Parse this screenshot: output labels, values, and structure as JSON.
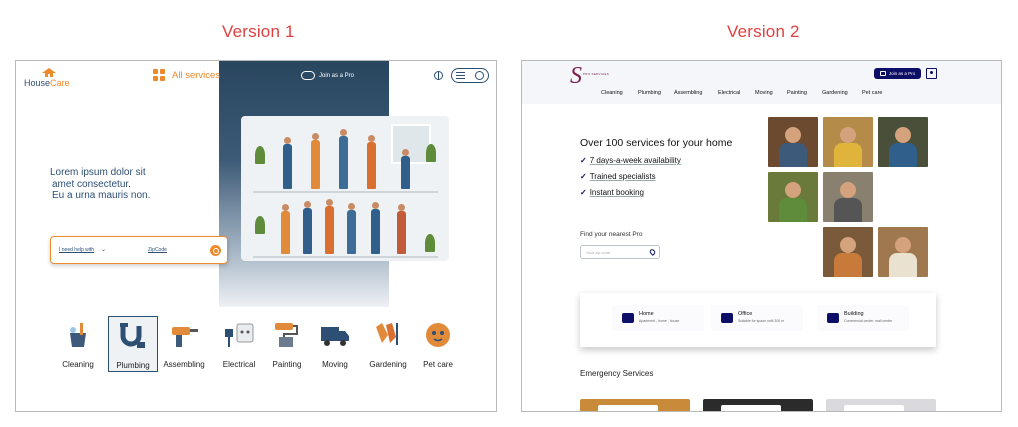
{
  "titles": {
    "v1": "Version 1",
    "v2": "Version 2"
  },
  "v1": {
    "logo": {
      "part1": "House",
      "part2": "Care"
    },
    "all_services": "All services",
    "join_pro": "Join as a Pro",
    "hero_lines": [
      "Lorem ipsum dolor sit",
      "amet consectetur.",
      "Eu a urna mauris non."
    ],
    "search": {
      "need_help": "I need help with",
      "zipcode": "ZipCode"
    },
    "categories": [
      {
        "label": "Cleaning",
        "icon": "cleaning-bucket-icon",
        "selected": false
      },
      {
        "label": "Plumbing",
        "icon": "pipe-icon",
        "selected": true
      },
      {
        "label": "Assembling",
        "icon": "drill-icon",
        "selected": false
      },
      {
        "label": "Electrical",
        "icon": "outlet-plug-icon",
        "selected": false
      },
      {
        "label": "Painting",
        "icon": "paint-roller-icon",
        "selected": false
      },
      {
        "label": "Moving",
        "icon": "truck-icon",
        "selected": false
      },
      {
        "label": "Gardening",
        "icon": "gloves-fork-icon",
        "selected": false
      },
      {
        "label": "Pet care",
        "icon": "pet-icon",
        "selected": false
      }
    ],
    "colors": {
      "accent": "#ed8a2c",
      "brand": "#2d4f74",
      "hero": "#29465f"
    }
  },
  "v2": {
    "logo_text": "PRO SERVICES",
    "join_pro": "Join as a Pro",
    "nav": [
      "Cleaning",
      "Plumbing",
      "Assembling",
      "Electrical",
      "Moving",
      "Painting",
      "Gardening",
      "Pet care"
    ],
    "hero_title": "Over 100 services for your home",
    "checks": [
      "7 days-a-week availability",
      "Trained specialists",
      "Instant booking"
    ],
    "find_label": "Find your nearest Pro",
    "zip_placeholder": "Your zip code",
    "types": [
      {
        "name": "Home",
        "desc": "Apartment , home , house"
      },
      {
        "name": "Office",
        "desc": "Suitable for space until 300 m"
      },
      {
        "name": "Building",
        "desc": "Commercial center, mall center"
      }
    ],
    "emergency_title": "Emergency Services",
    "colors": {
      "brand": "#0d0f66",
      "logo": "#7a1d4e"
    }
  }
}
